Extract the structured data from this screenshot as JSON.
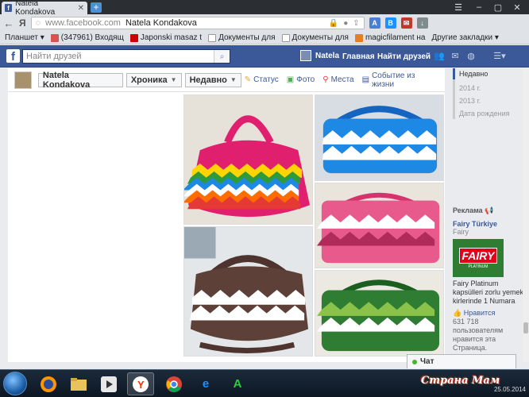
{
  "browser": {
    "tab_title": "Natela Kondakova",
    "url_host": "www.facebook.com",
    "url_title": "Natela Kondakova",
    "ya_label": "Я"
  },
  "bookmarks": [
    {
      "label": "Планшет ▾",
      "color": ""
    },
    {
      "label": "(347961) Входящ",
      "color": "#d9534f"
    },
    {
      "label": "Japonski masaz t",
      "color": "#cc0000"
    },
    {
      "label": "Документы для",
      "color": "#ffffff"
    },
    {
      "label": "Документы для",
      "color": "#ffffff"
    },
    {
      "label": "magicfilament на",
      "color": "#e67e22"
    },
    {
      "label": "Другие закладки ▾",
      "color": ""
    }
  ],
  "facebook": {
    "logo": "f",
    "search_placeholder": "Найти друзей",
    "user_name": "Natela",
    "home_link": "Главная",
    "find_friends_link": "Найти друзей"
  },
  "timeline": {
    "name_button": "Natela Kondakova",
    "chronicle_button": "Хроника",
    "recent_button": "Недавно",
    "actions": [
      {
        "icon": "status-icon",
        "label": "Статус"
      },
      {
        "icon": "photo-icon",
        "label": "Фото"
      },
      {
        "icon": "place-icon",
        "label": "Места"
      },
      {
        "icon": "life-event-icon",
        "label": "Событие из жизни"
      }
    ]
  },
  "rail": {
    "years": [
      "Недавно",
      "2014 г.",
      "2013 г.",
      "Дата рождения"
    ],
    "ad_header": "Реклама",
    "ad_title": "Fairy Türkiye",
    "ad_sub": "Fairy",
    "ad_logo": "FAIRY",
    "ad_logo_sub": "PLATINUM",
    "ad_text": "Fairy Platinum kapsülleri zorlu yemek kirlerinde 1 Numara",
    "ad_like": "Нравится",
    "ad_count": "631 718 пользователям нравится эта Страница."
  },
  "chat_label": "Чат",
  "taskbar": {
    "date": "25.05.2014",
    "watermark": "Страна Мам"
  },
  "colors": {
    "facebook_blue": "#3b5998",
    "link": "#3b5998"
  }
}
